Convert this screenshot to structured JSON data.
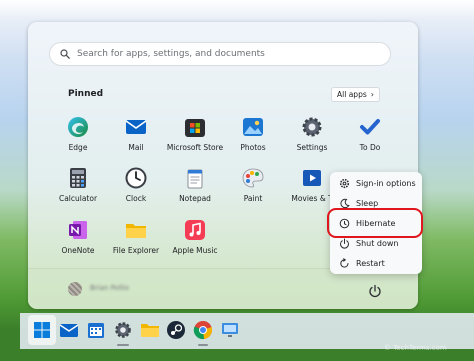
{
  "search": {
    "placeholder": "Search for apps, settings, and documents"
  },
  "pinned": {
    "title": "Pinned",
    "all_apps_label": "All apps",
    "apps": [
      {
        "label": "Edge",
        "icon": "edge-icon"
      },
      {
        "label": "Mail",
        "icon": "mail-icon"
      },
      {
        "label": "Microsoft Store",
        "icon": "store-icon"
      },
      {
        "label": "Photos",
        "icon": "photos-icon"
      },
      {
        "label": "Settings",
        "icon": "gear-icon"
      },
      {
        "label": "To Do",
        "icon": "checkmark-icon"
      },
      {
        "label": "Calculator",
        "icon": "calculator-icon"
      },
      {
        "label": "Clock",
        "icon": "clock-icon"
      },
      {
        "label": "Notepad",
        "icon": "notepad-icon"
      },
      {
        "label": "Paint",
        "icon": "paint-icon"
      },
      {
        "label": "Movies & T",
        "icon": "movies-icon"
      },
      {
        "label": "OneNote",
        "icon": "onenote-icon"
      },
      {
        "label": "File Explorer",
        "icon": "folder-icon"
      },
      {
        "label": "Apple Music",
        "icon": "music-icon"
      }
    ]
  },
  "user": {
    "name": "Brian Pollio"
  },
  "power_menu": {
    "items": [
      {
        "label": "Sign-in options",
        "icon": "gear-icon"
      },
      {
        "label": "Sleep",
        "icon": "moon-icon"
      },
      {
        "label": "Hibernate",
        "icon": "clock-icon"
      },
      {
        "label": "Shut down",
        "icon": "power-icon"
      },
      {
        "label": "Restart",
        "icon": "restart-icon"
      }
    ],
    "highlighted": "Hibernate"
  },
  "taskbar": {
    "icons": [
      "windows-start-icon",
      "mail-icon",
      "calendar-icon",
      "gear-icon",
      "folder-icon",
      "steam-icon",
      "chrome-icon",
      "remote-desktop-icon"
    ]
  },
  "watermark": "© TechTerms.com",
  "colors": {
    "highlight_ring": "#e0161e",
    "accent": "#0067c0"
  }
}
